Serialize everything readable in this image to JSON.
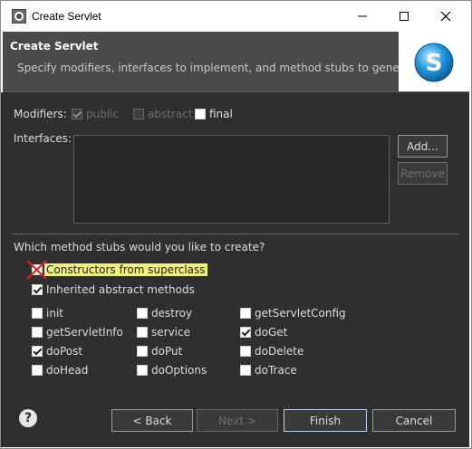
{
  "window": {
    "title": "Create Servlet"
  },
  "banner": {
    "title": "Create Servlet",
    "description": "Specify modifiers, interfaces to implement, and method stubs to generate.",
    "logo_letter": "S"
  },
  "modifiers": {
    "label": "Modifiers:",
    "public": {
      "label": "public",
      "checked": true,
      "enabled": false
    },
    "abstract": {
      "label": "abstract",
      "checked": false,
      "enabled": false
    },
    "final": {
      "label": "final",
      "checked": false,
      "enabled": true
    }
  },
  "interfaces": {
    "label": "Interfaces:",
    "add_label": "Add...",
    "remove_label": "Remove"
  },
  "stubs": {
    "question": "Which method stubs would you like to create?",
    "constructors": {
      "label": "Constructors from superclass",
      "checked": false
    },
    "inherited": {
      "label": "Inherited abstract methods",
      "checked": true
    },
    "methods": [
      {
        "label": "init",
        "checked": false
      },
      {
        "label": "destroy",
        "checked": false
      },
      {
        "label": "getServletConfig",
        "checked": false
      },
      {
        "label": "getServletInfo",
        "checked": false
      },
      {
        "label": "service",
        "checked": false
      },
      {
        "label": "doGet",
        "checked": true
      },
      {
        "label": "doPost",
        "checked": true
      },
      {
        "label": "doPut",
        "checked": false
      },
      {
        "label": "doDelete",
        "checked": false
      },
      {
        "label": "doHead",
        "checked": false
      },
      {
        "label": "doOptions",
        "checked": false
      },
      {
        "label": "doTrace",
        "checked": false
      }
    ]
  },
  "footer": {
    "back_label": "< Back",
    "next_label": "Next >",
    "finish_label": "Finish",
    "cancel_label": "Cancel"
  },
  "colors": {
    "dialog_bg": "#2f2f2f",
    "banner_bg": "#4a4a4a",
    "highlight": "#f0f07a",
    "annotation_red": "#e02020",
    "logo_blue": "#1e9be0"
  }
}
